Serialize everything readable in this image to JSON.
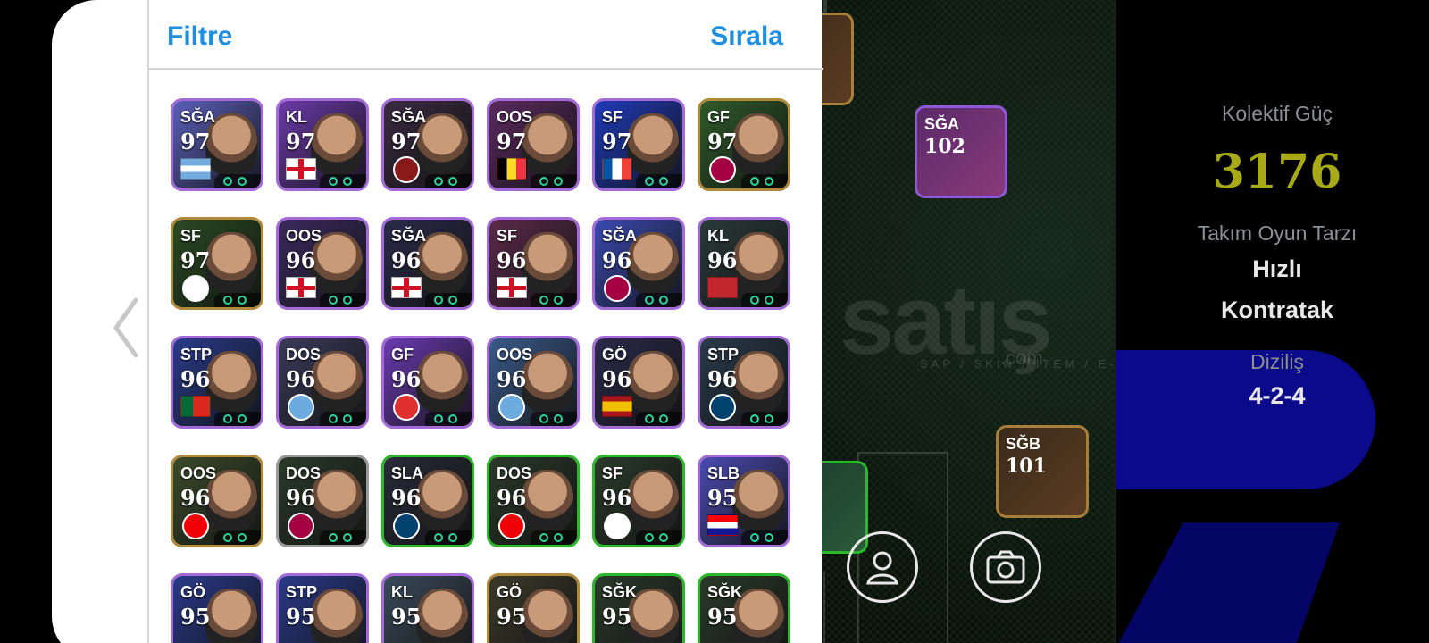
{
  "header": {
    "filter_label": "Filtre",
    "sort_label": "Sırala"
  },
  "team_info": {
    "collective_power_label": "Kolektif Güç",
    "collective_power_value": "3176",
    "play_style_label": "Takım Oyun Tarzı",
    "play_style_line1": "Hızlı",
    "play_style_line2": "Kontratak",
    "formation_label": "Diziliş",
    "formation_value": "4-2-4"
  },
  "watermark": {
    "main": "satış",
    "sub": "SAP / SKIN / ITEM / E-PIN",
    "com": ".com"
  },
  "pitch_cards": [
    {
      "pos": "",
      "rating": ""
    },
    {
      "pos": "SĞA",
      "rating": "102"
    },
    {
      "pos": "SĞB",
      "rating": "101"
    },
    {
      "pos": "",
      "rating": ""
    }
  ],
  "players": [
    {
      "pos": "SĞA",
      "rating": "97",
      "flag": "argentina",
      "frame": "#a46ad8",
      "bg": "#5b5fb8"
    },
    {
      "pos": "KL",
      "rating": "97",
      "flag": "england",
      "frame": "#a46ad8",
      "bg": "#6b3aa8"
    },
    {
      "pos": "SĞA",
      "rating": "97",
      "flag": "club-badge",
      "frame": "#a46ad8",
      "bg": "#3a2a40"
    },
    {
      "pos": "OOS",
      "rating": "97",
      "flag": "belgium",
      "frame": "#a46ad8",
      "bg": "#5a2a5e"
    },
    {
      "pos": "SF",
      "rating": "97",
      "flag": "france",
      "frame": "#a46ad8",
      "bg": "#1f3ab8"
    },
    {
      "pos": "GF",
      "rating": "97",
      "flag": "barcelona",
      "frame": "#b08a3a",
      "bg": "#2f5a2a"
    },
    {
      "pos": "SF",
      "rating": "97",
      "flag": "santos",
      "frame": "#b08a3a",
      "bg": "#2a4a22"
    },
    {
      "pos": "OOS",
      "rating": "96",
      "flag": "england",
      "frame": "#a46ad8",
      "bg": "#3a2a5e"
    },
    {
      "pos": "SĞA",
      "rating": "96",
      "flag": "england",
      "frame": "#a46ad8",
      "bg": "#2a2a4a"
    },
    {
      "pos": "SF",
      "rating": "96",
      "flag": "england",
      "frame": "#a46ad8",
      "bg": "#5a2a4a"
    },
    {
      "pos": "SĞA",
      "rating": "96",
      "flag": "barcelona",
      "frame": "#a46ad8",
      "bg": "#3a4ab0"
    },
    {
      "pos": "KL",
      "rating": "96",
      "flag": "morocco",
      "frame": "#a46ad8",
      "bg": "#2a3a3a"
    },
    {
      "pos": "STP",
      "rating": "96",
      "flag": "portugal",
      "frame": "#a46ad8",
      "bg": "#2a3a8a"
    },
    {
      "pos": "DOS",
      "rating": "96",
      "flag": "city-badge",
      "frame": "#a46ad8",
      "bg": "#3a3a5a"
    },
    {
      "pos": "GF",
      "rating": "96",
      "flag": "legend-badge",
      "frame": "#a46ad8",
      "bg": "#6a3ab0"
    },
    {
      "pos": "OOS",
      "rating": "96",
      "flag": "city-badge",
      "frame": "#a46ad8",
      "bg": "#3a5a8a"
    },
    {
      "pos": "GÖ",
      "rating": "96",
      "flag": "spain",
      "frame": "#a46ad8",
      "bg": "#2a2a4a"
    },
    {
      "pos": "STP",
      "rating": "96",
      "flag": "psg",
      "frame": "#a46ad8",
      "bg": "#2a3a4a"
    },
    {
      "pos": "OOS",
      "rating": "96",
      "flag": "arsenal",
      "frame": "#b08a3a",
      "bg": "#3a4a2a"
    },
    {
      "pos": "DOS",
      "rating": "96",
      "flag": "barcelona",
      "frame": "#9a9a9a",
      "bg": "#2a3a2a"
    },
    {
      "pos": "SLA",
      "rating": "96",
      "flag": "psg",
      "frame": "#2ab82a",
      "bg": "#2a2a3a"
    },
    {
      "pos": "DOS",
      "rating": "96",
      "flag": "arsenal",
      "frame": "#2ab82a",
      "bg": "#2a3a2a"
    },
    {
      "pos": "SF",
      "rating": "96",
      "flag": "madrid",
      "frame": "#2ab82a",
      "bg": "#2a3a2a"
    },
    {
      "pos": "SLB",
      "rating": "95",
      "flag": "croatia",
      "frame": "#a46ad8",
      "bg": "#4a4ab0"
    },
    {
      "pos": "GÖ",
      "rating": "95",
      "flag": "",
      "frame": "#a46ad8",
      "bg": "#2a3a8a"
    },
    {
      "pos": "STP",
      "rating": "95",
      "flag": "",
      "frame": "#a46ad8",
      "bg": "#2a3a8a"
    },
    {
      "pos": "KL",
      "rating": "95",
      "flag": "",
      "frame": "#a46ad8",
      "bg": "#3a4a5a"
    },
    {
      "pos": "GÖ",
      "rating": "95",
      "flag": "",
      "frame": "#b08a3a",
      "bg": "#3a3a2a"
    },
    {
      "pos": "SĞK",
      "rating": "95",
      "flag": "",
      "frame": "#2ab82a",
      "bg": "#2a3a2a"
    },
    {
      "pos": "SĞK",
      "rating": "95",
      "flag": "",
      "frame": "#2ab82a",
      "bg": "#2a3a2a"
    }
  ]
}
